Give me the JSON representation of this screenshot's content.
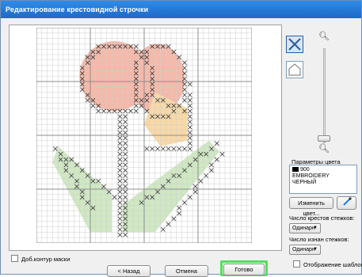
{
  "window": {
    "title": "Редактирование крестовидной строчки"
  },
  "canvas": {
    "cols": 40,
    "rows": 40,
    "background_color": "#ffffff",
    "grid_color": "#cfcfcf",
    "grid_major_color": "#8e8e8e",
    "stitch_color": "#333333",
    "fill_colors": {
      "petal": "#f6b8a8",
      "inner": "#f8d9a6",
      "leaf": "#cfe8c2"
    }
  },
  "tools": {
    "cross_stitch_icon": "cross-stitch-icon",
    "outline_icon": "house-outline-icon",
    "zoom_in_icon": "zoom-in-icon",
    "zoom_out_icon": "zoom-out-icon"
  },
  "color_params": {
    "label": "Параметры цвета",
    "swatch_color": "#000000",
    "code": "900",
    "brand": "EMBROIDERY",
    "name": "ЧЕРНЫЙ"
  },
  "change_color_button": "Изменить цвет...",
  "dropper_icon": "eyedropper-icon",
  "front_stitches": {
    "label": "Число крестов стежков:",
    "value": "Одинарн"
  },
  "back_stitches": {
    "label": "Число изнан стежков:",
    "value": "Одинарн"
  },
  "add_mask_outline": {
    "label": "Доб.контур маски",
    "checked": false
  },
  "show_template": {
    "label": "Отображение шаблона",
    "checked": false
  },
  "buttons": {
    "back": "< Назад",
    "cancel": "Отмена",
    "ok": "Готово"
  },
  "highlight_color": "#4ee25a"
}
